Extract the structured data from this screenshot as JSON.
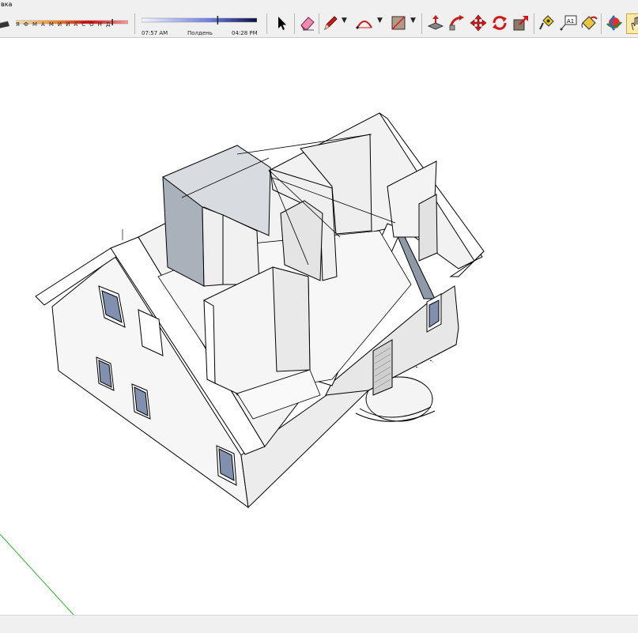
{
  "menubar": {
    "visible_text": "вка"
  },
  "shadow_settings": {
    "months": [
      "Я",
      "Ф",
      "М",
      "А",
      "М",
      "И",
      "И",
      "А",
      "С",
      "О",
      "Н",
      "Д"
    ],
    "months_text": "Я Ф М А М И И А С О Н Д",
    "month_slider_level": 0.86,
    "time_start": "07:57 AM",
    "time_mid": "Полдень",
    "time_end": "04:28 PM",
    "time_slider_level": 0.66
  },
  "toolbar": {
    "tools": [
      {
        "icon": "select-arrow-icon"
      },
      {
        "icon": "eraser-icon"
      },
      {
        "icon": "pencil-line-icon"
      },
      {
        "icon": "arc-icon"
      },
      {
        "icon": "rectangle-shape-icon"
      },
      {
        "icon": "push-pull-icon"
      },
      {
        "icon": "follow-me-icon"
      },
      {
        "icon": "move-icon"
      },
      {
        "icon": "rotate-icon"
      },
      {
        "icon": "scale-icon"
      },
      {
        "icon": "tape-measure-icon"
      },
      {
        "icon": "text-label-icon"
      },
      {
        "icon": "paint-bucket-icon"
      },
      {
        "icon": "orbit-icon"
      },
      {
        "icon": "pan-icon"
      }
    ],
    "text_tool_label": "A1"
  },
  "colors": {
    "toolbar_bg": "#f0f0f0",
    "model_face": "#ececec",
    "model_edge": "#000000",
    "window_glass": "#8290b0",
    "shaded_wall": "#a9b1ba",
    "green_axis": "#2db52d"
  }
}
